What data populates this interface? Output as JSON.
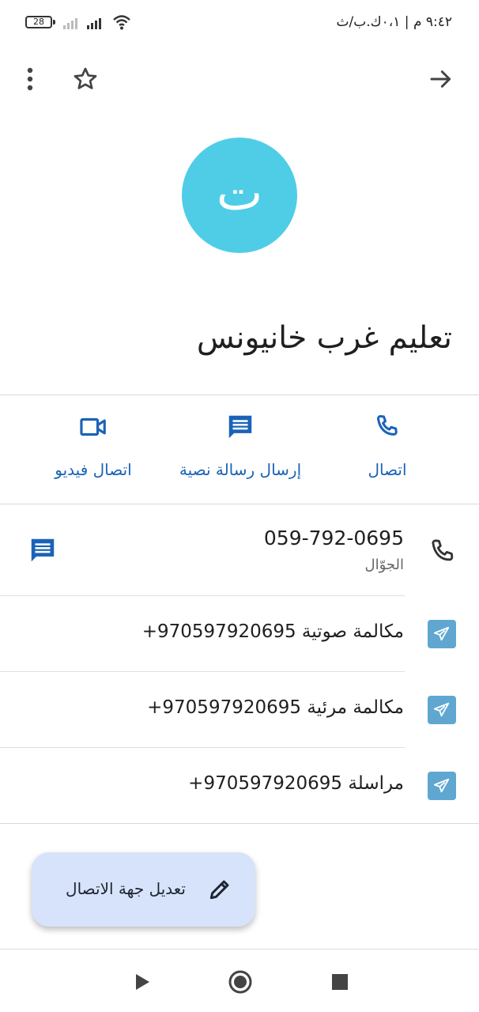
{
  "status_bar": {
    "time": "٩:٤٢ م | ٠،١ك.ب/ث",
    "battery": "28"
  },
  "top_bar": {
    "more_icon": "more-vert-icon",
    "star_icon": "star-outline-icon",
    "back_icon": "arrow-forward-icon"
  },
  "contact": {
    "avatar_letter": "ت",
    "avatar_color": "#4fcde6",
    "name": "تعليم غرب خانيونس"
  },
  "actions": [
    {
      "label": "اتصال",
      "icon": "phone-icon"
    },
    {
      "label": "إرسال رسالة نصية",
      "icon": "message-icon"
    },
    {
      "label": "اتصال فيديو",
      "icon": "videocam-icon"
    }
  ],
  "phone": {
    "number": "059-792-0695",
    "type": "الجوّال"
  },
  "telegram_rows": [
    {
      "text": "مكالمة صوتية 970597920695+"
    },
    {
      "text": "مكالمة مرئية 970597920695+"
    },
    {
      "text": "مراسلة 970597920695+"
    }
  ],
  "fab": {
    "label": "تعديل جهة الاتصال",
    "icon": "edit-pencil-icon"
  },
  "colors": {
    "accent": "#1a63b8",
    "telegram": "#5fa7d1",
    "fab_bg": "#d7e3fb"
  }
}
